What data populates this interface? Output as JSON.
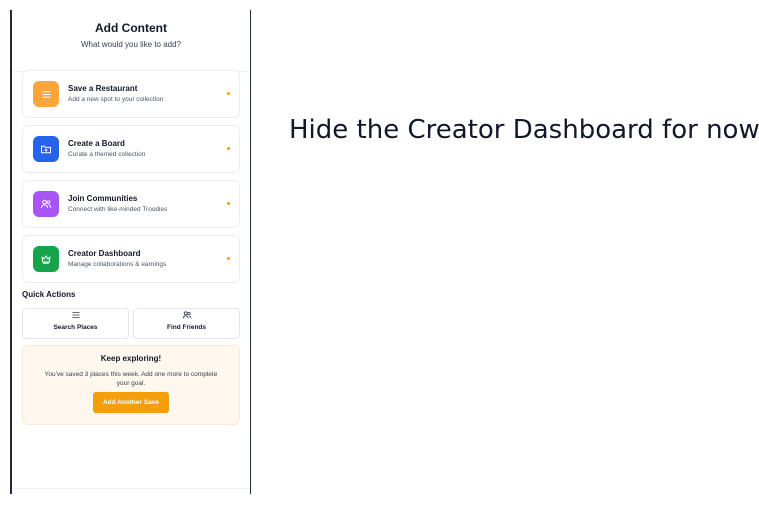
{
  "header": {
    "title": "Add Content",
    "subtitle": "What would you like to add?"
  },
  "options": [
    {
      "title": "Save a Restaurant",
      "description": "Add a new spot to your collection",
      "icon": "list-icon",
      "color": "#f7a53c"
    },
    {
      "title": "Create a Board",
      "description": "Curate a themed collection",
      "icon": "folder-plus-icon",
      "color": "#2563eb"
    },
    {
      "title": "Join Communities",
      "description": "Connect with like-minded Troodies",
      "icon": "users-icon",
      "color": "#a855f7"
    },
    {
      "title": "Creator Dashboard",
      "description": "Manage collaborations & earnings",
      "icon": "crown-icon",
      "color": "#16a34a"
    }
  ],
  "quick_actions": {
    "title": "Quick Actions",
    "items": [
      {
        "label": "Search Places",
        "icon": "list-icon"
      },
      {
        "label": "Find Friends",
        "icon": "users-icon"
      }
    ]
  },
  "keep_exploring": {
    "title": "Keep exploring!",
    "text": "You've saved 3 places this week. Add one more to complete your goal.",
    "button": "Add Another Save",
    "accent": "#f59e0b"
  },
  "caption": "Hide the Creator Dashboard for now"
}
